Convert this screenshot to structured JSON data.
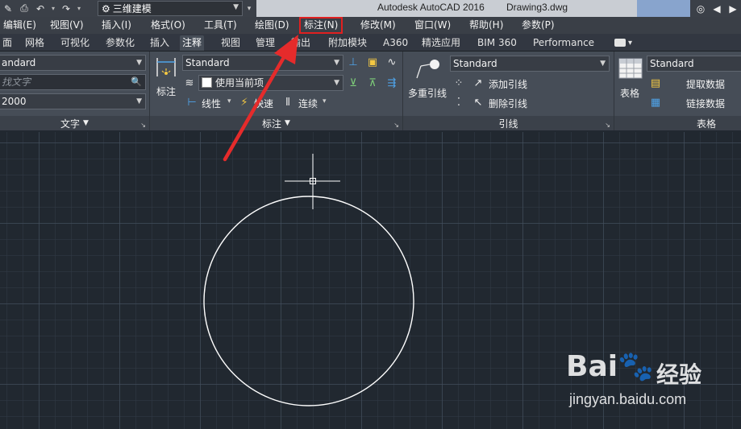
{
  "titlebar": {
    "workspace": "三维建模",
    "app_title": "Autodesk AutoCAD 2016",
    "document": "Drawing3.dwg"
  },
  "menubar": {
    "items": [
      "编辑(E)",
      "视图(V)",
      "插入(I)",
      "格式(O)",
      "工具(T)",
      "绘图(D)",
      "标注(N)",
      "修改(M)",
      "窗口(W)",
      "帮助(H)",
      "参数(P)"
    ],
    "highlighted": "标注(N)"
  },
  "tabs": {
    "items": [
      "面",
      "网格",
      "可视化",
      "参数化",
      "插入",
      "注释",
      "视图",
      "管理",
      "输出",
      "附加模块",
      "A360",
      "精选应用",
      "BIM 360",
      "Performance"
    ],
    "active": "注释"
  },
  "ribbon": {
    "text_panel": {
      "style": "andard",
      "find_placeholder": "找文字",
      "height": "2000",
      "footer": "文字"
    },
    "dim_panel": {
      "big_button": "标注",
      "style": "Standard",
      "layer": "使用当前项",
      "linear": "线性",
      "quick": "快速",
      "continue": "连续",
      "footer": "标注"
    },
    "leader_panel": {
      "big_button": "多重引线",
      "style": "Standard",
      "add": "添加引线",
      "remove": "删除引线",
      "footer": "引线"
    },
    "table_panel": {
      "big_button": "表格",
      "style": "Standard",
      "extract": "提取数据",
      "link": "链接数据",
      "footer": "表格"
    }
  },
  "watermark": {
    "logo_left": "Bai",
    "logo_right": "经验",
    "url": "jingyan.baidu.com"
  },
  "colors": {
    "highlight": "#e02020",
    "arrow": "#e52b2b",
    "canvas": "#212830",
    "circle": "#ffffff"
  }
}
